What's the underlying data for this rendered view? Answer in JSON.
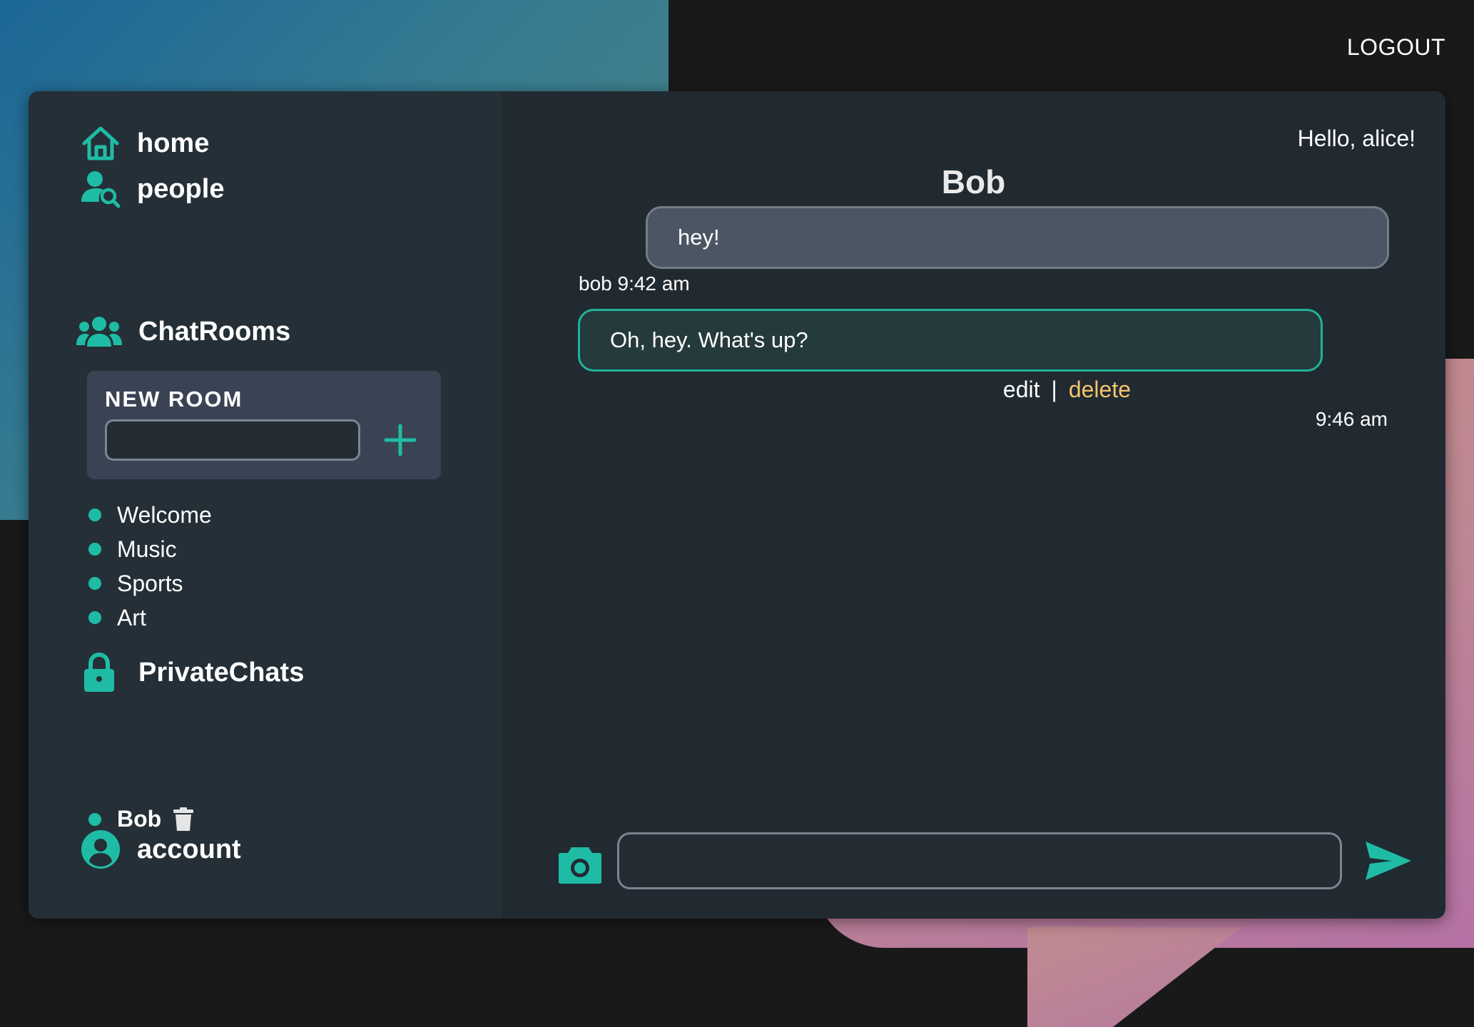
{
  "colors": {
    "accent": "#1fbca5",
    "delete": "#f5c56b",
    "sidebar_bg": "#242f37",
    "main_bg": "#212a31",
    "incoming_bubble": "#4b5563",
    "outgoing_border": "#1fb29c"
  },
  "header": {
    "logout_label": "LOGOUT"
  },
  "sidebar": {
    "nav": [
      {
        "label": "home",
        "icon": "home-icon"
      },
      {
        "label": "people",
        "icon": "people-search-icon"
      }
    ],
    "chatrooms": {
      "title": "ChatRooms",
      "icon": "group-icon",
      "new_room": {
        "title": "NEW ROOM",
        "input_value": "",
        "add_icon": "plus-icon"
      },
      "rooms": [
        "Welcome",
        "Music",
        "Sports",
        "Art"
      ]
    },
    "private_chats": {
      "title": "PrivateChats",
      "icon": "lock-icon",
      "items": [
        {
          "label": "Bob",
          "delete_icon": "trash-icon"
        }
      ]
    },
    "account": {
      "label": "account",
      "icon": "user-circle-icon"
    }
  },
  "chat": {
    "greeting": "Hello, alice!",
    "title": "Bob",
    "messages": [
      {
        "from": "bob",
        "text": "hey!",
        "meta": "bob 9:42 am"
      },
      {
        "from": "alice",
        "text": "Oh, hey. What's up?",
        "meta": "9:46 am",
        "edit_label": "edit",
        "separator": "|",
        "delete_label": "delete"
      }
    ],
    "composer": {
      "input_value": "",
      "camera_icon": "camera-icon",
      "send_icon": "send-icon"
    }
  }
}
